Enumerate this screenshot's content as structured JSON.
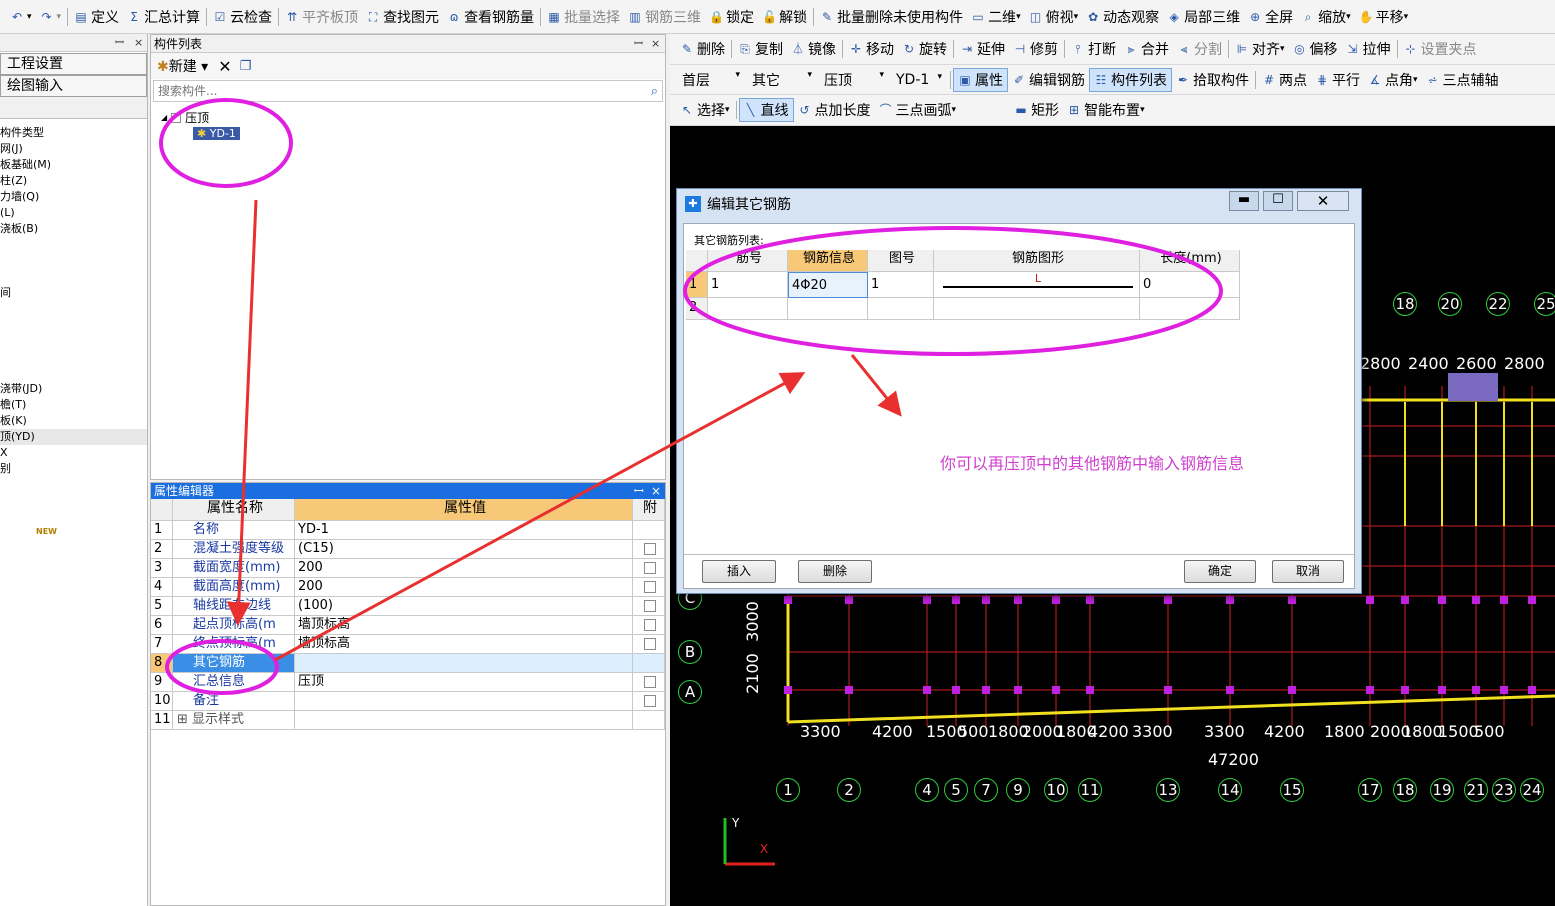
{
  "toolbar1": [
    {
      "label": "",
      "icon": "undo-icon"
    },
    {
      "label": "",
      "icon": "redo-icon",
      "disabled": true
    },
    {
      "label": "定义",
      "icon": "define-icon"
    },
    {
      "label": "汇总计算",
      "icon": "sigma-icon"
    },
    {
      "label": "云检查",
      "icon": "cloud-check-icon"
    },
    {
      "label": "平齐板顶",
      "icon": "align-top-icon",
      "disabled": true
    },
    {
      "label": "查找图元",
      "icon": "binoculars-icon"
    },
    {
      "label": "查看钢筋量",
      "icon": "view-rebar-icon"
    },
    {
      "label": "批量选择",
      "icon": "batch-select-icon",
      "disabled": true
    },
    {
      "label": "钢筋三维",
      "icon": "rebar-3d-icon",
      "disabled": true
    },
    {
      "label": "锁定",
      "icon": "lock-icon"
    },
    {
      "label": "解锁",
      "icon": "unlock-icon"
    },
    {
      "label": "批量删除未使用构件",
      "icon": "batch-delete-icon"
    },
    {
      "label": "二维",
      "icon": "2d-icon"
    },
    {
      "label": "俯视",
      "icon": "top-view-icon"
    },
    {
      "label": "动态观察",
      "icon": "orbit-icon"
    },
    {
      "label": "局部三维",
      "icon": "partial-3d-icon"
    },
    {
      "label": "全屏",
      "icon": "fullscreen-icon"
    },
    {
      "label": "缩放",
      "icon": "zoom-icon"
    },
    {
      "label": "平移",
      "icon": "pan-icon"
    }
  ],
  "toolbar2": [
    {
      "label": "删除",
      "icon": "delete-icon"
    },
    {
      "label": "复制",
      "icon": "copy-icon"
    },
    {
      "label": "镜像",
      "icon": "mirror-icon"
    },
    {
      "label": "移动",
      "icon": "move-icon"
    },
    {
      "label": "旋转",
      "icon": "rotate-icon"
    },
    {
      "label": "延伸",
      "icon": "extend-icon"
    },
    {
      "label": "修剪",
      "icon": "trim-icon"
    },
    {
      "label": "打断",
      "icon": "break-icon"
    },
    {
      "label": "合并",
      "icon": "merge-icon"
    },
    {
      "label": "分割",
      "icon": "split-icon",
      "disabled": true
    },
    {
      "label": "对齐",
      "icon": "align-icon"
    },
    {
      "label": "偏移",
      "icon": "offset-icon"
    },
    {
      "label": "拉伸",
      "icon": "stretch-icon"
    },
    {
      "label": "设置夹点",
      "icon": "grip-icon",
      "disabled": true
    }
  ],
  "toolbar3": {
    "floor": "首层",
    "category": "其它",
    "type": "压顶",
    "element": "YD-1",
    "buttons": [
      {
        "label": "属性",
        "icon": "properties-icon",
        "active": true
      },
      {
        "label": "编辑钢筋",
        "icon": "edit-rebar-icon"
      },
      {
        "label": "构件列表",
        "icon": "component-list-icon",
        "active": true
      },
      {
        "label": "拾取构件",
        "icon": "pick-icon"
      },
      {
        "label": "两点",
        "icon": "two-point-icon"
      },
      {
        "label": "平行",
        "icon": "parallel-icon"
      },
      {
        "label": "点角",
        "icon": "point-angle-icon"
      },
      {
        "label": "三点辅轴",
        "icon": "three-point-axis-icon"
      }
    ]
  },
  "toolbar4": [
    {
      "label": "选择",
      "icon": "select-icon"
    },
    {
      "label": "直线",
      "icon": "line-icon",
      "active": true
    },
    {
      "label": "点加长度",
      "icon": "point-length-icon"
    },
    {
      "label": "三点画弧",
      "icon": "arc-icon"
    },
    {
      "label": "矩形",
      "icon": "rect-icon"
    },
    {
      "label": "智能布置",
      "icon": "smart-layout-icon"
    }
  ],
  "nav": {
    "tabs": [
      "工程设置",
      "绘图输入"
    ],
    "items": [
      "构件类型",
      "网(J)",
      "板基础(M)",
      "柱(Z)",
      "力墙(Q)",
      "(L)",
      "浇板(B)",
      "",
      "",
      "",
      "间",
      "",
      "",
      "",
      "",
      "",
      "浇带(JD)",
      "檐(T)",
      "板(K)",
      "顶(YD)",
      "X",
      "别"
    ],
    "new_badge": "NEW"
  },
  "component_list": {
    "title": "构件列表",
    "new_label": "新建",
    "search_placeholder": "搜索构件...",
    "tree": {
      "parent": "压顶",
      "child": "YD-1"
    }
  },
  "property_editor": {
    "title": "属性编辑器",
    "headers": {
      "name": "属性名称",
      "value": "属性值",
      "attach": "附"
    },
    "rows": [
      {
        "num": "1",
        "name": "名称",
        "value": "YD-1",
        "check": false
      },
      {
        "num": "2",
        "name": "混凝土强度等级",
        "value": "(C15)",
        "check": true
      },
      {
        "num": "3",
        "name": "截面宽度(mm)",
        "value": "200",
        "check": true
      },
      {
        "num": "4",
        "name": "截面高度(mm)",
        "value": "200",
        "check": true
      },
      {
        "num": "5",
        "name": "轴线距左边线",
        "value": "(100)",
        "check": true
      },
      {
        "num": "6",
        "name": "起点顶标高(m",
        "value": "墙顶标高",
        "check": true
      },
      {
        "num": "7",
        "name": "终点顶标高(m",
        "value": "墙顶标高",
        "check": true
      },
      {
        "num": "8",
        "name": "其它钢筋",
        "value": "",
        "check": false,
        "selected": true
      },
      {
        "num": "9",
        "name": "汇总信息",
        "value": "压顶",
        "check": true
      },
      {
        "num": "10",
        "name": "备注",
        "value": "",
        "check": true
      },
      {
        "num": "11",
        "name": "显示样式",
        "value": "",
        "check": false,
        "expand": "+"
      }
    ]
  },
  "dialog": {
    "title": "编辑其它钢筋",
    "list_label": "其它钢筋列表:",
    "headers": [
      "筋号",
      "钢筋信息",
      "图号",
      "钢筋图形",
      "长度(mm)"
    ],
    "rows": [
      {
        "num": "1",
        "bar": "1",
        "info": "4Φ20",
        "fig": "1",
        "shape": "L",
        "length": "0"
      },
      {
        "num": "2",
        "bar": "",
        "info": "",
        "fig": "",
        "shape": "",
        "length": ""
      }
    ],
    "insert": "插入",
    "delete": "删除",
    "ok": "确定",
    "cancel": "取消"
  },
  "annotation": "你可以再压顶中的其他钢筋中输入钢筋信息",
  "cad": {
    "top_axes": [
      "18",
      "20",
      "22",
      "25"
    ],
    "top_dims": [
      "2800",
      "2400",
      "2600",
      "2800"
    ],
    "row_axes": [
      "C",
      "B",
      "A"
    ],
    "left_dims": [
      "2100",
      "3000"
    ],
    "bottom_dims": [
      "3300",
      "4200",
      "1500",
      "500",
      "1800",
      "2000",
      "1800",
      "4200",
      "3300",
      "3300",
      "4200",
      "1800",
      "2000",
      "1800",
      "1500",
      "500"
    ],
    "total": "47200",
    "bottom_axes": [
      "1",
      "2",
      "4",
      "5",
      "7",
      "9",
      "10",
      "11",
      "13",
      "14",
      "15",
      "17",
      "18",
      "19",
      "21",
      "23",
      "24"
    ],
    "ucs_y": "Y",
    "ucs_x": "X"
  },
  "colors": {
    "highlight": "#e020e0",
    "arrow": "#e83030",
    "annotation": "#d040d0",
    "cad_bg": "#000000",
    "selection": "#3a8ee6"
  }
}
